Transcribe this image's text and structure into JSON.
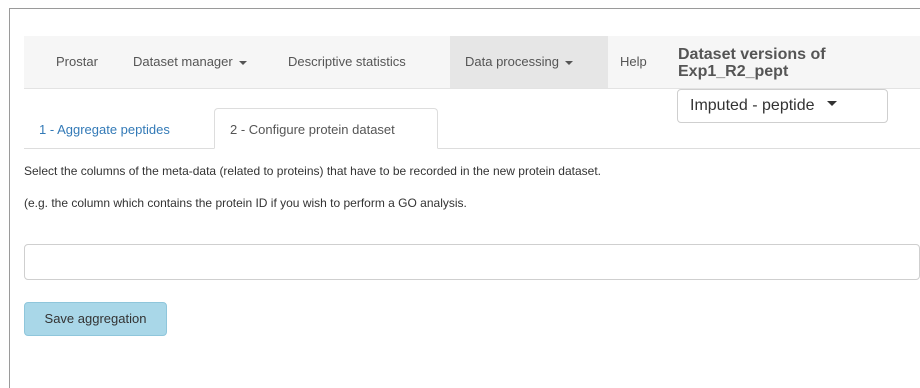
{
  "navbar": {
    "items": [
      {
        "label": "Prostar"
      },
      {
        "label": "Dataset manager"
      },
      {
        "label": "Descriptive statistics"
      },
      {
        "label": "Data processing"
      },
      {
        "label": "Help"
      }
    ],
    "brand_line1": "Dataset versions of",
    "brand_line2": "Exp1_R2_pept"
  },
  "version_select": {
    "value": "Imputed - peptide"
  },
  "tabs": [
    {
      "label": "1 - Aggregate peptides"
    },
    {
      "label": "2 - Configure protein dataset"
    }
  ],
  "content": {
    "instruction": "Select the columns of the meta-data (related to proteins) that have to be recorded in the new protein dataset.",
    "example": "(e.g. the column which contains the protein ID if you wish to perform a GO analysis.",
    "selector_value": "",
    "save_label": "Save aggregation"
  }
}
